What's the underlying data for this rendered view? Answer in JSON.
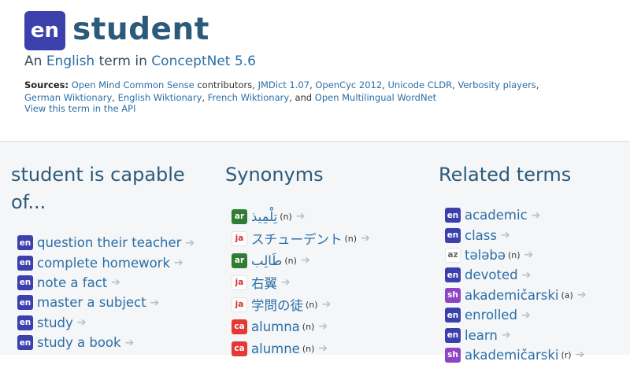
{
  "header": {
    "lang_code": "en",
    "term": "student",
    "subtitle_prefix": "An ",
    "subtitle_lang": "English",
    "subtitle_mid": " term in ",
    "subtitle_db": "ConceptNet 5.6",
    "sources_label": "Sources:",
    "sources": [
      {
        "text": "Open Mind Common Sense",
        "link": true
      },
      {
        "text": " contributors, ",
        "link": false
      },
      {
        "text": "JMDict 1.07",
        "link": true
      },
      {
        "text": ", ",
        "link": false
      },
      {
        "text": "OpenCyc 2012",
        "link": true
      },
      {
        "text": ", ",
        "link": false
      },
      {
        "text": "Unicode CLDR",
        "link": true
      },
      {
        "text": ", ",
        "link": false
      },
      {
        "text": "Verbosity players",
        "link": true
      },
      {
        "text": ", ",
        "link": false
      },
      {
        "text": "German Wiktionary",
        "link": true
      },
      {
        "text": ", ",
        "link": false
      },
      {
        "text": "English Wiktionary",
        "link": true
      },
      {
        "text": ", ",
        "link": false
      },
      {
        "text": "French Wiktionary",
        "link": true
      },
      {
        "text": ", and ",
        "link": false
      },
      {
        "text": "Open Multilingual WordNet",
        "link": true
      }
    ],
    "api_link": "View this term in the API"
  },
  "colors": {
    "en": "#3c40ad",
    "ja": "#ffffff",
    "ar": "#2e7d32",
    "ca": "#e53935",
    "az": "#ffffff",
    "sh": "#8e44c4"
  },
  "columns": [
    {
      "title": "student is capable of...",
      "items": [
        {
          "lang": "en",
          "text": "question their teacher"
        },
        {
          "lang": "en",
          "text": "complete homework"
        },
        {
          "lang": "en",
          "text": "note a fact"
        },
        {
          "lang": "en",
          "text": "master a subject"
        },
        {
          "lang": "en",
          "text": "study"
        },
        {
          "lang": "en",
          "text": "study a book"
        }
      ]
    },
    {
      "title": "Synonyms",
      "items": [
        {
          "lang": "ar",
          "text": "تِلْمِيذ",
          "pos": "(n)"
        },
        {
          "lang": "ja",
          "text": "スチューデント",
          "pos": "(n)"
        },
        {
          "lang": "ar",
          "text": "طَالِب",
          "pos": "(n)"
        },
        {
          "lang": "ja",
          "text": "右翼",
          "pos": ""
        },
        {
          "lang": "ja",
          "text": "学問の徒",
          "pos": "(n)"
        },
        {
          "lang": "ca",
          "text": "alumna",
          "pos": "(n)"
        },
        {
          "lang": "ca",
          "text": "alumne",
          "pos": "(n)"
        }
      ]
    },
    {
      "title": "Related terms",
      "items": [
        {
          "lang": "en",
          "text": "academic",
          "pos": ""
        },
        {
          "lang": "en",
          "text": "class",
          "pos": ""
        },
        {
          "lang": "az",
          "text": "tələbə",
          "pos": "(n)"
        },
        {
          "lang": "en",
          "text": "devoted",
          "pos": ""
        },
        {
          "lang": "sh",
          "text": "akademičarski",
          "pos": "(a)"
        },
        {
          "lang": "en",
          "text": "enrolled",
          "pos": ""
        },
        {
          "lang": "en",
          "text": "learn",
          "pos": ""
        },
        {
          "lang": "sh",
          "text": "akademičarski",
          "pos": "(r)"
        }
      ]
    }
  ],
  "arrow": "➔"
}
